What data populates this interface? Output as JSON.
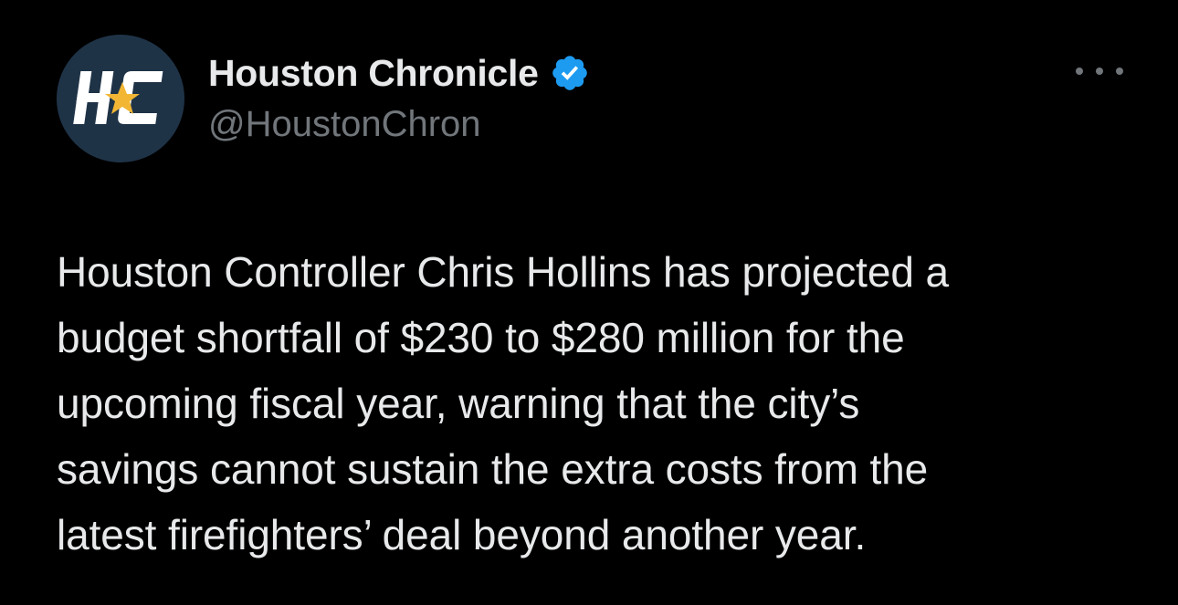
{
  "tweet": {
    "author": {
      "display_name": "Houston Chronicle",
      "handle": "@HoustonChron",
      "avatar_text": "HC",
      "verified": true
    },
    "text": "Houston Controller Chris Hollins has projected a\nbudget shortfall of $230 to $280 million for the\nupcoming fiscal year, warning that the city’s\nsavings cannot sustain the extra costs from the\nlatest firefighters’ deal beyond another year."
  },
  "icons": {
    "verified": "verified-badge-icon",
    "more": "more-options-icon",
    "star": "star-icon"
  },
  "colors": {
    "background": "#000000",
    "text_primary": "#e7e9ea",
    "text_secondary": "#71767b",
    "verified_blue": "#1d9bf0",
    "avatar_bg": "#1f3347",
    "star_gold": "#f2b634"
  }
}
